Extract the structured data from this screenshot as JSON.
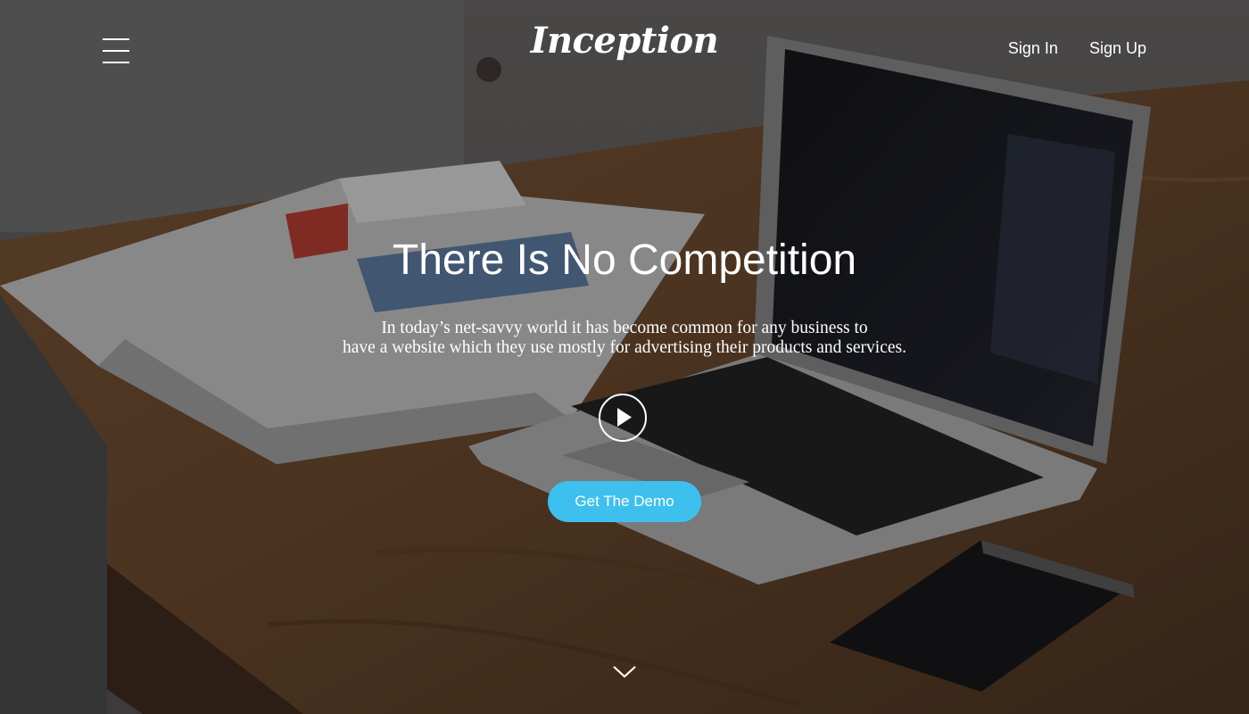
{
  "header": {
    "logo_text": "Inception",
    "sign_in_label": "Sign In",
    "sign_up_label": "Sign Up",
    "menu_icon": "hamburger-menu-icon"
  },
  "hero": {
    "headline": "There Is No Competition",
    "subtext_line1": "In today’s net-savvy world it has become common for any business to",
    "subtext_line2": "have a website which they use mostly for advertising their products and services.",
    "play_icon": "play-icon",
    "cta_label": "Get The Demo",
    "scroll_icon": "chevron-down-icon",
    "background_image_description": ""
  },
  "colors": {
    "accent": "#3ec0ef",
    "text": "#ffffff"
  }
}
